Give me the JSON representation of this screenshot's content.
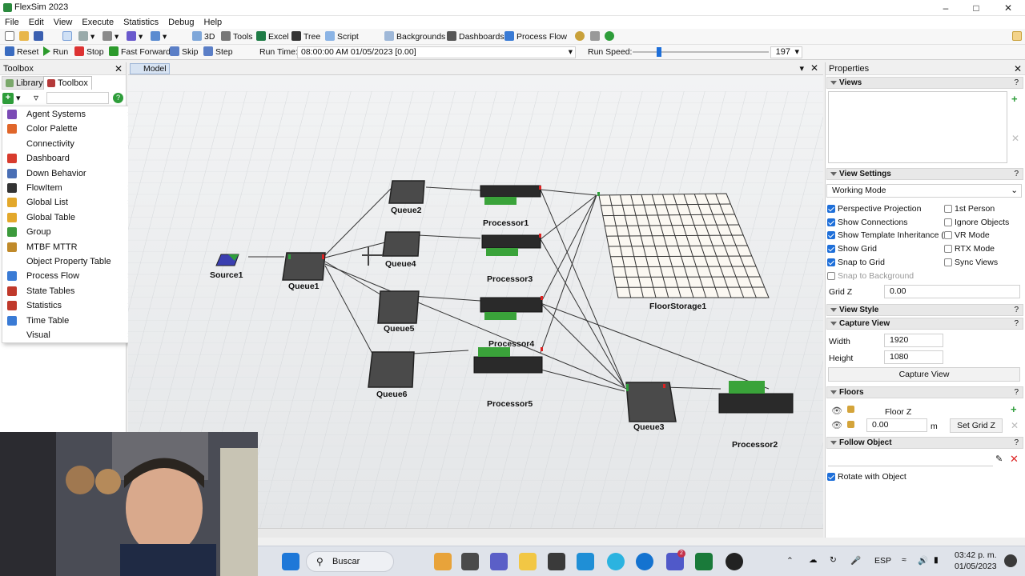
{
  "window": {
    "title": "FlexSim 2023"
  },
  "menu": [
    "File",
    "Edit",
    "View",
    "Execute",
    "Statistics",
    "Debug",
    "Help"
  ],
  "toolbar": {
    "btn_3d": "3D",
    "tools": "Tools",
    "excel": "Excel",
    "tree": "Tree",
    "script": "Script",
    "backgrounds": "Backgrounds",
    "dashboards": "Dashboards",
    "process_flow": "Process Flow"
  },
  "runbar": {
    "reset": "Reset",
    "run": "Run",
    "stop": "Stop",
    "fast_forward": "Fast Forward",
    "skip": "Skip",
    "step": "Step",
    "run_time_label": "Run Time:",
    "run_time_value": "08:00:00 AM  01/05/2023  [0.00]",
    "run_speed_label": "Run Speed:",
    "run_speed_value": "197"
  },
  "toolbox": {
    "title": "Toolbox",
    "tabs": [
      "Library",
      "Toolbox"
    ],
    "search_placeholder": "",
    "menu_items": [
      {
        "label": "Agent Systems",
        "submenu": true,
        "icon": "agent-icon",
        "color": "#7b4bb5"
      },
      {
        "label": "Color Palette",
        "submenu": true,
        "icon": "palette-icon",
        "color": "#e0662a"
      },
      {
        "label": "Connectivity",
        "submenu": true,
        "icon": "connectivity-icon",
        "color": "#ffffff"
      },
      {
        "label": "Dashboard",
        "submenu": false,
        "icon": "dashboard-icon",
        "color": "#d83b2d"
      },
      {
        "label": "Down Behavior",
        "submenu": false,
        "icon": "down-behavior-icon",
        "color": "#4a6fb5"
      },
      {
        "label": "FlowItem",
        "submenu": true,
        "icon": "flowitem-icon",
        "color": "#333333"
      },
      {
        "label": "Global List",
        "submenu": true,
        "icon": "global-list-icon",
        "color": "#e3a82b"
      },
      {
        "label": "Global Table",
        "submenu": false,
        "icon": "global-table-icon",
        "color": "#e3a82b"
      },
      {
        "label": "Group",
        "submenu": false,
        "icon": "group-icon",
        "color": "#3c9a3c"
      },
      {
        "label": "MTBF MTTR",
        "submenu": false,
        "icon": "mtbf-icon",
        "color": "#c08a2a"
      },
      {
        "label": "Object Property Table",
        "submenu": false,
        "icon": "property-table-icon",
        "color": "#ffffff"
      },
      {
        "label": "Process Flow",
        "submenu": true,
        "icon": "process-flow-icon",
        "color": "#3a7bd5"
      },
      {
        "label": "State Tables",
        "submenu": true,
        "icon": "state-tables-icon",
        "color": "#c0392b"
      },
      {
        "label": "Statistics",
        "submenu": true,
        "icon": "statistics-icon",
        "color": "#c0392b"
      },
      {
        "label": "Time Table",
        "submenu": false,
        "icon": "time-table-icon",
        "color": "#3a7bd5"
      },
      {
        "label": "Visual",
        "submenu": true,
        "icon": "visual-icon",
        "color": "#ffffff"
      }
    ]
  },
  "model": {
    "tab": "Model",
    "objects": {
      "source1": "Source1",
      "queue1": "Queue1",
      "queue2": "Queue2",
      "queue3": "Queue3",
      "queue4": "Queue4",
      "queue5": "Queue5",
      "queue6": "Queue6",
      "processor1": "Processor1",
      "processor2": "Processor2",
      "processor3": "Processor3",
      "processor4": "Processor4",
      "processor5": "Processor5",
      "floorstorage1": "FloorStorage1"
    }
  },
  "properties": {
    "title": "Properties",
    "views": "Views",
    "view_settings": "View Settings",
    "working_mode": "Working Mode",
    "checks_left": [
      {
        "label": "Perspective Projection",
        "checked": true,
        "disabled": false
      },
      {
        "label": "Show Connections",
        "checked": true,
        "disabled": false
      },
      {
        "label": "Show Template Inheritance (T)",
        "checked": true,
        "disabled": false
      },
      {
        "label": "Show Grid",
        "checked": true,
        "disabled": false
      },
      {
        "label": "Snap to Grid",
        "checked": true,
        "disabled": false
      },
      {
        "label": "Snap to Background",
        "checked": false,
        "disabled": true
      }
    ],
    "checks_right": [
      {
        "label": "1st Person",
        "checked": false
      },
      {
        "label": "Ignore Objects",
        "checked": false
      },
      {
        "label": "VR Mode",
        "checked": false
      },
      {
        "label": "RTX Mode",
        "checked": false
      },
      {
        "label": "Sync Views",
        "checked": false
      }
    ],
    "grid_z_label": "Grid Z",
    "grid_z_value": "0.00",
    "view_style": "View Style",
    "capture_view": "Capture View",
    "width_label": "Width",
    "width_value": "1920",
    "height_label": "Height",
    "height_value": "1080",
    "capture_button": "Capture View",
    "floors": "Floors",
    "floor_name": "Floor Z",
    "floor_value": "0.00",
    "floor_unit": "m",
    "set_grid_z": "Set Grid Z",
    "follow_object": "Follow Object",
    "rotate_with_object": "Rotate with Object",
    "help": "?"
  },
  "taskbar": {
    "search": "Buscar",
    "lang": "ESP",
    "time": "03:42 p. m.",
    "date": "01/05/2023",
    "teams_badge": "2"
  }
}
